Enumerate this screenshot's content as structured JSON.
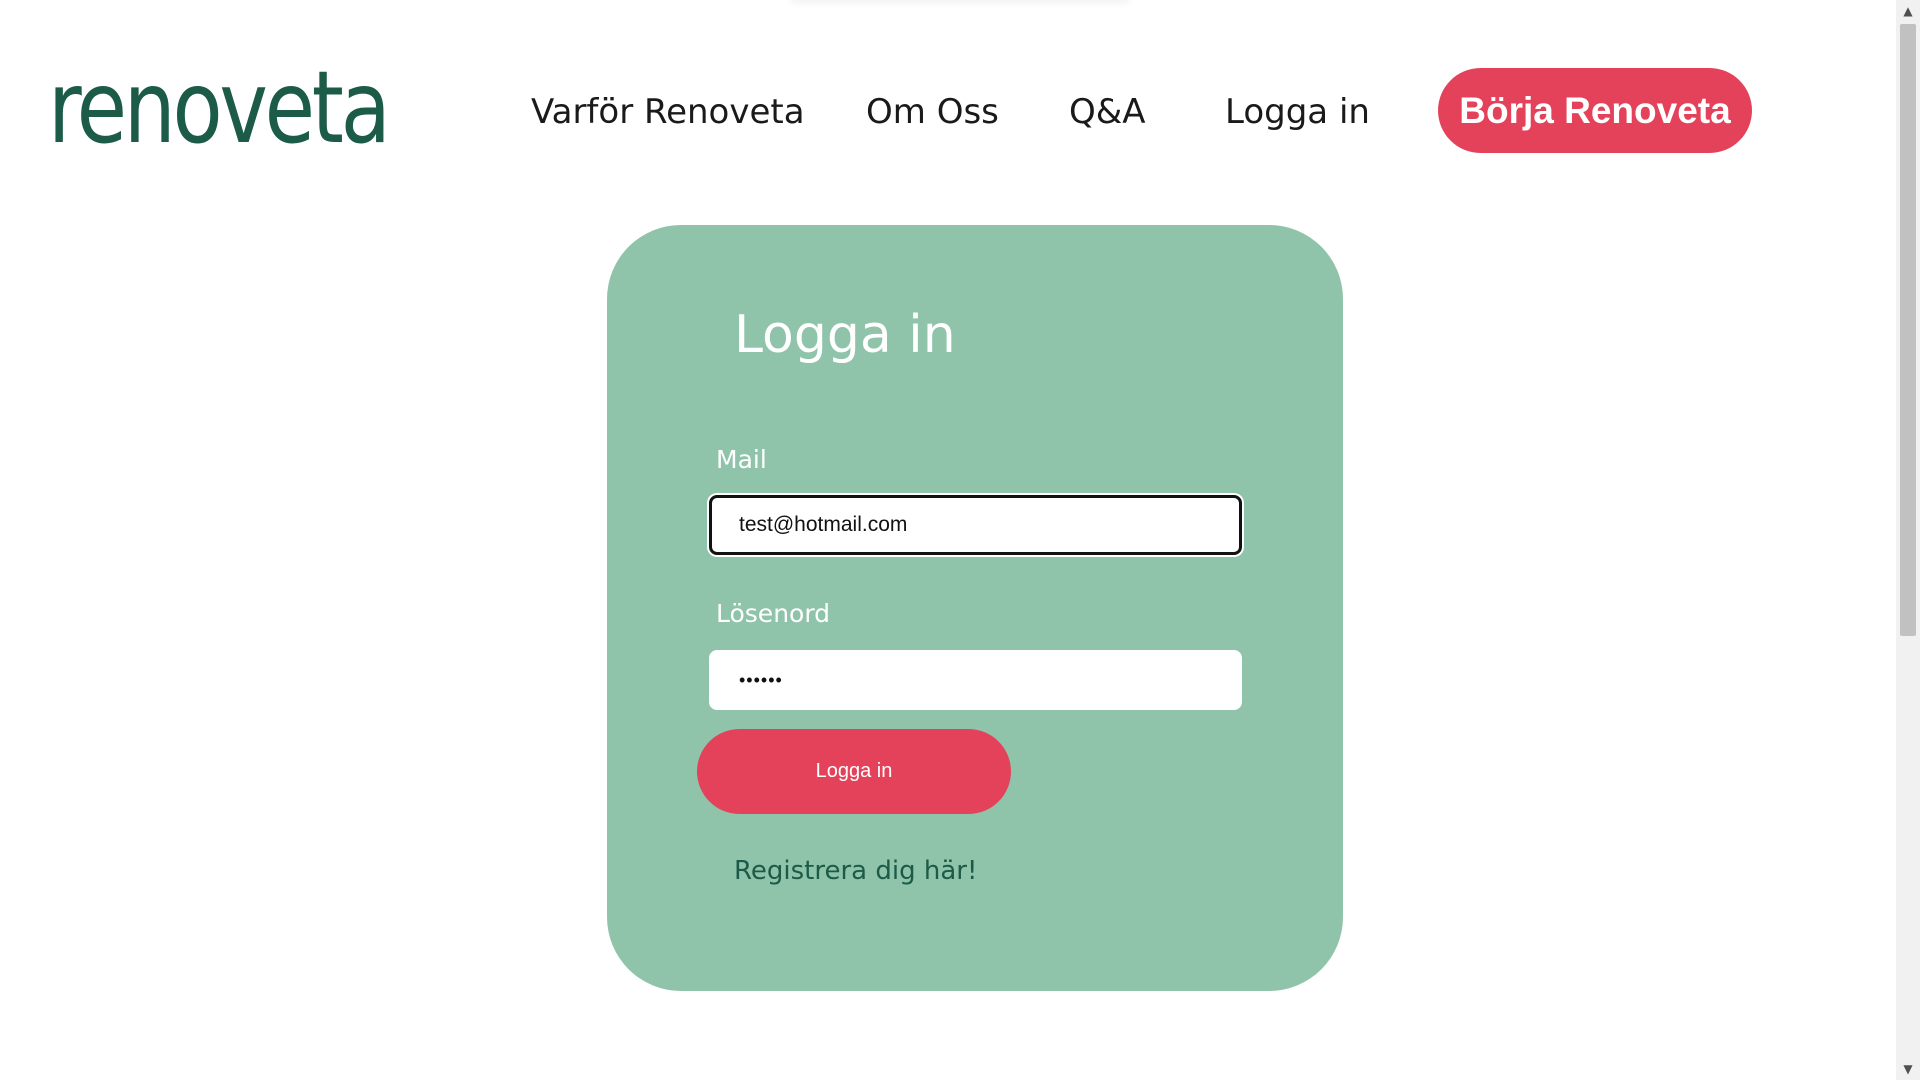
{
  "header": {
    "logo_text": "renoveta",
    "nav": {
      "varfor": "Varför Renoveta",
      "om_oss": "Om Oss",
      "qa": "Q&A",
      "logga_in": "Logga in"
    },
    "cta_label": "Börja Renoveta"
  },
  "login": {
    "title": "Logga in",
    "mail_label": "Mail",
    "mail_value": "test@hotmail.com",
    "password_label": "Lösenord",
    "password_value": "••••••",
    "submit_label": "Logga in",
    "register_link": "Registrera dig här!"
  },
  "scrollbar": {
    "up_icon": "▲",
    "down_icon": "▼"
  },
  "colors": {
    "brand_green": "#1b5b48",
    "card_green": "#8fc3aa",
    "accent_red": "#e3425a"
  }
}
